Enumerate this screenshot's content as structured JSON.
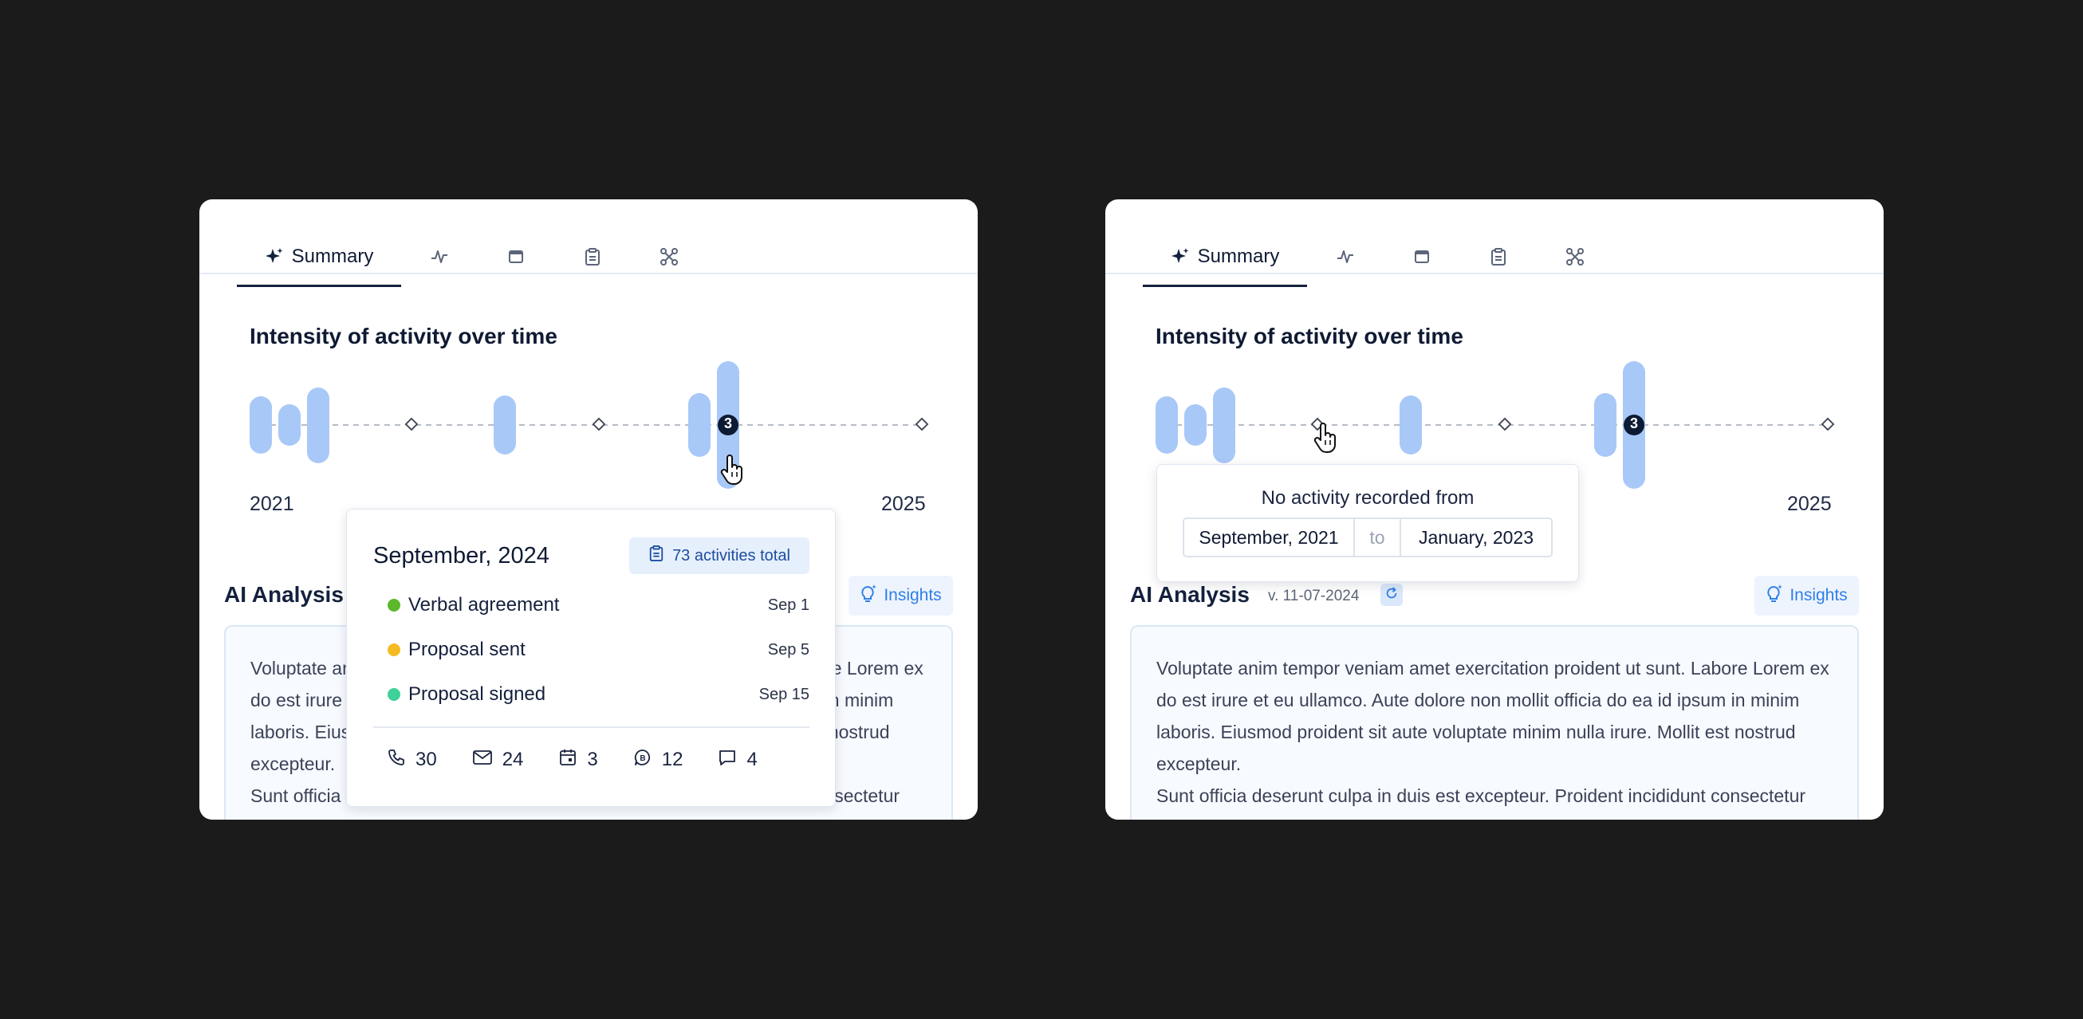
{
  "colors": {
    "background": "#1b1b1b",
    "bar": "#a8c8f8",
    "accent": "#2f7fe8",
    "verbal_agreement": "#5cb82a",
    "proposal_sent": "#f4bb22",
    "proposal_signed": "#3fd19a"
  },
  "left": {
    "tabs": {
      "summary_label": "Summary",
      "icons": [
        "activity-icon",
        "window-icon",
        "clipboard-icon",
        "network-icon"
      ]
    },
    "chart_title": "Intensity of activity over time",
    "year_start": "2021",
    "year_end": "2025",
    "marker_badge": "3",
    "ai": {
      "title": "AI Analysis",
      "insights_label": "Insights",
      "text_1": "Voluptate anim tempor veniam amet exercitation proident ut sunt. Labore Lorem ex do est irure et eu ullamco. Aute dolore non mollit officia do ea id ipsum in minim laboris. Eiusmod proident sit aute voluptate minim nulla irure. Mollit est nostrud excepteur.",
      "text_2": "Sunt officia deserunt culpa in duis est excepteur. Proident incididunt consectetur exercitation aliqua voluptate exercitation proident dolore nulla."
    },
    "popover": {
      "month": "September, 2024",
      "total": "73 activities total",
      "items": [
        {
          "label": "Verbal agreement",
          "date": "Sep 1"
        },
        {
          "label": "Proposal sent",
          "date": "Sep 5"
        },
        {
          "label": "Proposal signed",
          "date": "Sep 15"
        }
      ],
      "stats": {
        "calls": "30",
        "emails": "24",
        "meetings": "3",
        "whatsapp": "12",
        "chats": "4"
      }
    }
  },
  "right": {
    "tabs": {
      "summary_label": "Summary",
      "icons": [
        "activity-icon",
        "window-icon",
        "clipboard-icon",
        "network-icon"
      ]
    },
    "chart_title": "Intensity of activity over time",
    "year_end": "2025",
    "marker_badge": "3",
    "ai": {
      "title": "AI Analysis",
      "version": "v. 11-07-2024",
      "insights_label": "Insights",
      "text_1": "Voluptate anim tempor veniam amet exercitation proident ut sunt. Labore Lorem ex do est irure et eu ullamco. Aute dolore non mollit officia do ea id ipsum in minim laboris. Eiusmod proident sit aute voluptate minim nulla irure. Mollit est nostrud excepteur.",
      "text_2": "Sunt officia deserunt culpa in duis est excepteur. Proident incididunt consectetur exercitation aliqua voluptate exercitation proident dolore nulla."
    },
    "tooltip": {
      "title": "No activity recorded from",
      "from": "September, 2021",
      "separator": "to",
      "to": "January, 2023"
    }
  }
}
